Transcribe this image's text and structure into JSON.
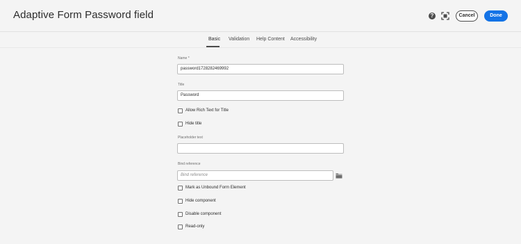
{
  "header": {
    "title": "Adaptive Form Password field",
    "help_icon": "?",
    "cancel_label": "Cancel",
    "done_label": "Done",
    "accent_color": "#1473e6"
  },
  "tabs": [
    {
      "label": "Basic",
      "active": true
    },
    {
      "label": "Validation",
      "active": false
    },
    {
      "label": "Help Content",
      "active": false
    },
    {
      "label": "Accessibility",
      "active": false
    }
  ],
  "form": {
    "name": {
      "label": "Name *",
      "value": "password1728282469992"
    },
    "title": {
      "label": "Title",
      "value": "Password"
    },
    "allow_rich_text": {
      "label": "Allow Rich Text for Title",
      "checked": false
    },
    "hide_title": {
      "label": "Hide title",
      "checked": false
    },
    "placeholder_text": {
      "label": "Placeholder text",
      "value": ""
    },
    "bind_reference": {
      "label": "Bind reference",
      "placeholder": "Bind reference",
      "icon": "folder-icon"
    },
    "mark_unbound": {
      "label": "Mark as Unbound Form Element",
      "checked": false
    },
    "hide_component": {
      "label": "Hide component",
      "checked": false
    },
    "disable_component": {
      "label": "Disable component",
      "checked": false
    },
    "read_only": {
      "label": "Read-only",
      "checked": false
    }
  }
}
